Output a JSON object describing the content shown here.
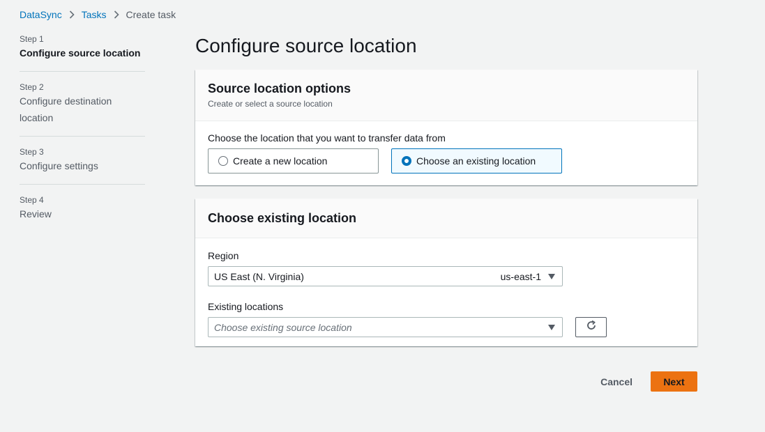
{
  "breadcrumb": {
    "items": [
      "DataSync",
      "Tasks"
    ],
    "current": "Create task"
  },
  "steps": [
    {
      "num": "Step 1",
      "title": "Configure source location",
      "active": true
    },
    {
      "num": "Step 2",
      "title": "Configure destination location",
      "active": false
    },
    {
      "num": "Step 3",
      "title": "Configure settings",
      "active": false
    },
    {
      "num": "Step 4",
      "title": "Review",
      "active": false
    }
  ],
  "page_title": "Configure source location",
  "source_options": {
    "title": "Source location options",
    "subtitle": "Create or select a source location",
    "label": "Choose the location that you want to transfer data from",
    "options": [
      "Create a new location",
      "Choose an existing location"
    ],
    "selected": "Choose an existing location"
  },
  "existing": {
    "title": "Choose existing location",
    "region_label": "Region",
    "region_value": "US East (N. Virginia)",
    "region_code": "us-east-1",
    "locations_label": "Existing locations",
    "locations_placeholder": "Choose existing source location"
  },
  "actions": {
    "cancel": "Cancel",
    "next": "Next"
  },
  "colors": {
    "link": "#0073bb",
    "primary": "#ec7211",
    "background": "#f2f3f3"
  }
}
